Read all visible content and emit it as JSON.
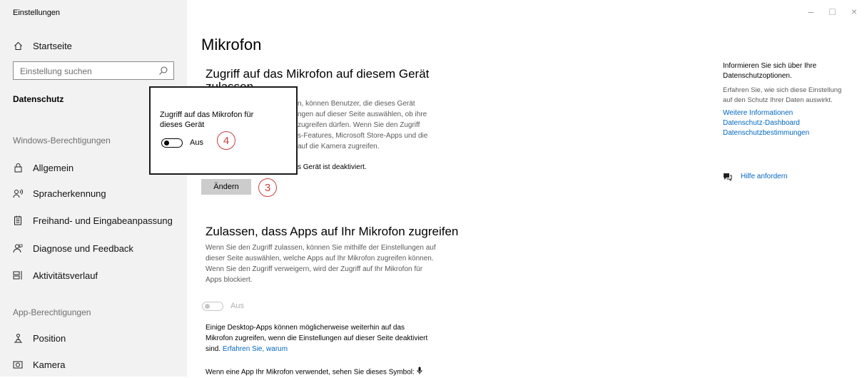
{
  "window": {
    "title": "Einstellungen",
    "minimize": "–",
    "maximize": "□",
    "close": "×"
  },
  "sidebar": {
    "home": "Startseite",
    "search_placeholder": "Einstellung suchen",
    "current_section": "Datenschutz",
    "windows_permissions_heading": "Windows-Berechtigungen",
    "windows_items": [
      "Allgemein",
      "Spracherkennung",
      "Freihand- und Eingabeanpassung",
      "Diagnose und Feedback",
      "Aktivitätsverlauf"
    ],
    "app_permissions_heading": "App-Berechtigungen",
    "app_items": [
      "Position",
      "Kamera"
    ]
  },
  "main": {
    "title": "Mikrofon",
    "section1_heading_line1": "Zugriff auf das Mikrofon auf diesem Gerät",
    "section1_heading_line2": "zulassen",
    "section1_desc": [
      "n, können Benutzer, die dieses Gerät",
      "ngen auf dieser Seite auswählen, ob ihre",
      "zugreifen dürfen. Wenn Sie den Zugriff",
      "s-Features, Microsoft Store-Apps und die",
      "auf die Kamera zugreifen."
    ],
    "section1_status": "s Gerät ist deaktiviert.",
    "change_button": "Ändern",
    "section2_heading": "Zulassen, dass Apps auf Ihr Mikrofon zugreifen",
    "section2_desc": [
      "Wenn Sie den Zugriff zulassen, können Sie mithilfe der Einstellungen auf",
      "dieser Seite auswählen, welche Apps auf Ihr Mikrofon zugreifen können.",
      "Wenn Sie den Zugriff verweigern, wird der Zugriff auf Ihr Mikrofon für",
      "Apps blockiert."
    ],
    "apps_toggle_label": "Aus",
    "desktop_note_line1": "Einige Desktop-Apps können möglicherweise weiterhin auf das",
    "desktop_note_line2": "Mikrofon zugreifen, wenn die Einstellungen auf dieser Seite deaktiviert",
    "desktop_note_line3": "sind.",
    "desktop_note_link": "Erfahren Sie, warum",
    "mic_symbol_note": "Wenn eine App Ihr Mikrofon verwendet, sehen Sie dieses Symbol:"
  },
  "popup": {
    "label_line1": "Zugriff auf das Mikrofon für",
    "label_line2": "dieses Gerät",
    "toggle_label": "Aus"
  },
  "callouts": {
    "change": "3",
    "popup": "4"
  },
  "right_panel": {
    "heading_line1": "Informieren Sie sich über Ihre",
    "heading_line2": "Datenschutzoptionen.",
    "text_line1": "Erfahren Sie, wie sich diese Einstellung",
    "text_line2": "auf den Schutz Ihrer Daten auswirkt.",
    "links": [
      "Weitere Informationen",
      "Datenschutz-Dashboard",
      "Datenschutzbestimmungen"
    ],
    "help": "Hilfe anfordern"
  },
  "colors": {
    "accent": "#0067c0",
    "callout": "#c94040",
    "sidebar_bg": "#f2f2f2"
  }
}
